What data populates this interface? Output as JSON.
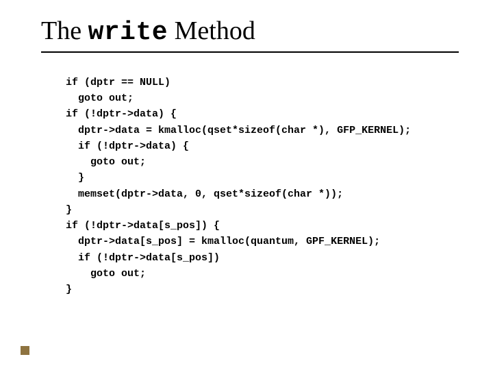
{
  "title": {
    "pre": "The ",
    "mono": "write",
    "post": " Method"
  },
  "code": {
    "l1": "if (dptr == NULL)",
    "l2": "  goto out;",
    "l3": "if (!dptr->data) {",
    "l4": "  dptr->data = kmalloc(qset*sizeof(char *), GFP_KERNEL);",
    "l5": "  if (!dptr->data) {",
    "l6": "    goto out;",
    "l7": "  }",
    "l8": "  memset(dptr->data, 0, qset*sizeof(char *));",
    "l9": "}",
    "l10": "if (!dptr->data[s_pos]) {",
    "l11": "  dptr->data[s_pos] = kmalloc(quantum, GPF_KERNEL);",
    "l12": "  if (!dptr->data[s_pos])",
    "l13": "    goto out;",
    "l14": "}"
  }
}
